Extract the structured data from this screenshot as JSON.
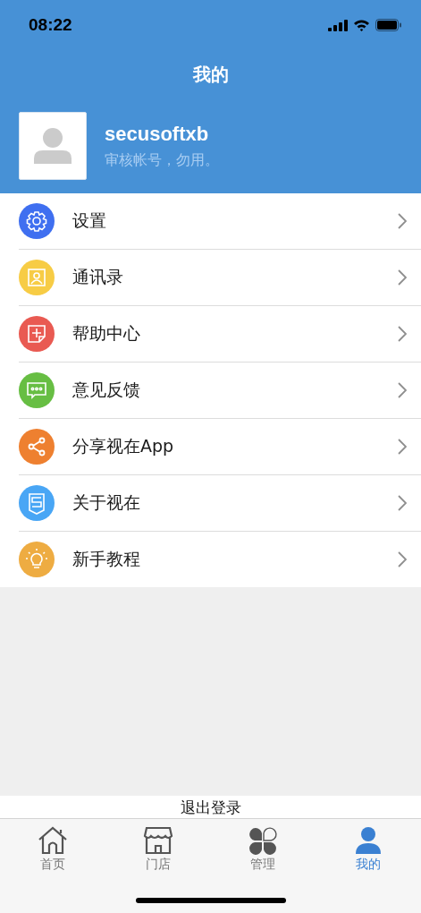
{
  "status_bar": {
    "time": "08:22"
  },
  "header": {
    "title": "我的"
  },
  "profile": {
    "name": "secusoftxb",
    "note": "审核帐号，勿用。"
  },
  "menu": [
    {
      "label": "设置",
      "kind": "gear",
      "color": "#3f6ff0"
    },
    {
      "label": "通讯录",
      "kind": "contacts",
      "color": "#f7cc45"
    },
    {
      "label": "帮助中心",
      "kind": "help",
      "color": "#e95a52"
    },
    {
      "label": "意见反馈",
      "kind": "feedback",
      "color": "#67be43"
    },
    {
      "label": "分享视在App",
      "kind": "share",
      "color": "#ee8030"
    },
    {
      "label": "关于视在",
      "kind": "about",
      "color": "#49a6f5"
    },
    {
      "label": "新手教程",
      "kind": "tutorial",
      "color": "#eeac42"
    }
  ],
  "logout_button": "退出登录",
  "tabs": [
    {
      "label": "首页",
      "kind": "home",
      "selected": false
    },
    {
      "label": "门店",
      "kind": "store",
      "selected": false
    },
    {
      "label": "管理",
      "kind": "manage",
      "selected": false
    },
    {
      "label": "我的",
      "kind": "me",
      "selected": true
    }
  ]
}
